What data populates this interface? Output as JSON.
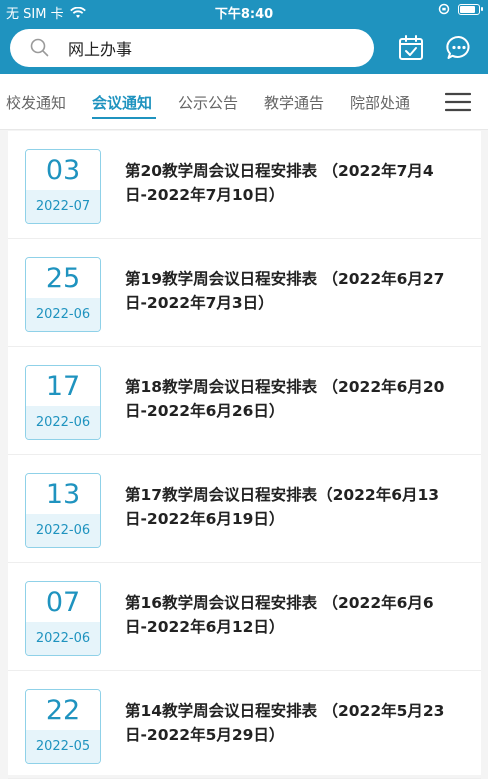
{
  "status_bar": {
    "carrier": "无 SIM 卡",
    "time": "下午8:40",
    "battery_level": 0.9
  },
  "search": {
    "value": "网上办事",
    "icon": "search-icon"
  },
  "top_actions": [
    {
      "name": "calendar-icon"
    },
    {
      "name": "chat-icon"
    }
  ],
  "tabs": [
    {
      "label": "校发通知"
    },
    {
      "label": "会议通知"
    },
    {
      "label": "公示公告"
    },
    {
      "label": "教学通告"
    },
    {
      "label": "院部处通"
    }
  ],
  "active_tab": 1,
  "items": [
    {
      "day": "03",
      "ym": "2022-07",
      "title": "第20教学周会议日程安排表 （2022年7月4日-2022年7月10日）"
    },
    {
      "day": "25",
      "ym": "2022-06",
      "title": "第19教学周会议日程安排表 （2022年6月27日-2022年7月3日）"
    },
    {
      "day": "17",
      "ym": "2022-06",
      "title": "第18教学周会议日程安排表 （2022年6月20日-2022年6月26日）"
    },
    {
      "day": "13",
      "ym": "2022-06",
      "title": "第17教学周会议日程安排表（2022年6月13日-2022年6月19日）"
    },
    {
      "day": "07",
      "ym": "2022-06",
      "title": "第16教学周会议日程安排表 （2022年6月6日-2022年6月12日）"
    },
    {
      "day": "22",
      "ym": "2022-05",
      "title": "第14教学周会议日程安排表 （2022年5月23日-2022年5月29日）"
    }
  ],
  "colors": {
    "accent": "#1f93bf",
    "date_border": "#8fd1e8",
    "date_bg": "#e6f4fa"
  }
}
